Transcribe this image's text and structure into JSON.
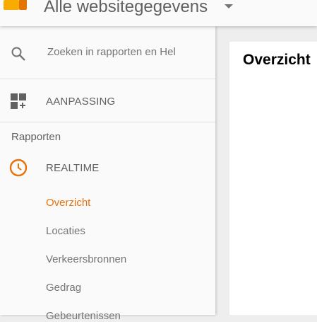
{
  "header": {
    "title": "Alle websitegegevens",
    "logo_icon": "analytics-logo-icon"
  },
  "sidebar": {
    "search": {
      "placeholder": "Zoeken in rapporten en Hel"
    },
    "customization": {
      "label": "AANPASSING"
    },
    "section_label": "Rapporten",
    "realtime": {
      "label": "REALTIME",
      "items": [
        {
          "label": "Overzicht",
          "active": true
        },
        {
          "label": "Locaties"
        },
        {
          "label": "Verkeersbronnen"
        },
        {
          "label": "Gedrag"
        },
        {
          "label": "Gebeurtenissen"
        }
      ]
    }
  },
  "main": {
    "title": "Overzicht"
  },
  "colors": {
    "accent": "#e8710a"
  }
}
